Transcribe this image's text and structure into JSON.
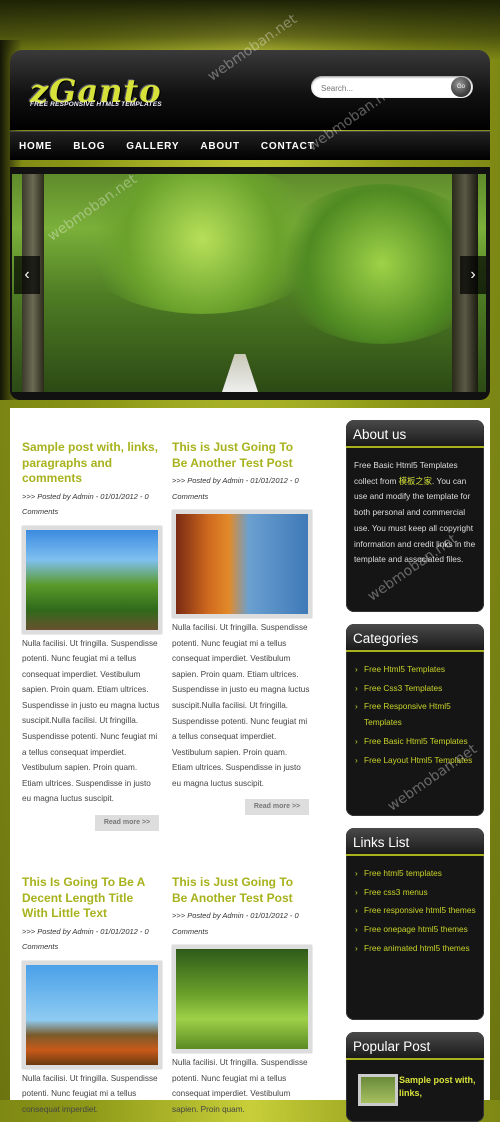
{
  "site": {
    "logo": "zGanto",
    "tagline": "FREE RESPONSIVE HTML5 TEMPLATES"
  },
  "search": {
    "placeholder": "Search...",
    "button_label": "Go"
  },
  "nav": {
    "items": [
      "HOME",
      "BLOG",
      "GALLERY",
      "ABOUT",
      "CONTACT"
    ]
  },
  "slider": {
    "prev_icon": "‹",
    "next_icon": "›"
  },
  "posts": [
    {
      "title": "Sample post with, links, paragraphs and comments",
      "meta": ">>> Posted by Admin - 01/01/2012 - 0 Comments",
      "body": "Nulla facilisi. Ut fringilla. Suspendisse potenti. Nunc feugiat mi a tellus consequat imperdiet. Vestibulum sapien. Proin quam. Etiam ultrices. Suspendisse in justo eu magna luctus suscipit.Nulla facilisi. Ut fringilla. Suspendisse potenti. Nunc feugiat mi a tellus consequat imperdiet. Vestibulum sapien. Proin quam. Etiam ultrices. Suspendisse in justo eu magna luctus suscipit.",
      "read_more": "Read more >>"
    },
    {
      "title": "This is Just Going To Be Another Test Post",
      "meta": ">>> Posted by Admin - 01/01/2012 - 0 Comments",
      "body": "Nulla facilisi. Ut fringilla. Suspendisse potenti. Nunc feugiat mi a tellus consequat imperdiet. Vestibulum sapien. Proin quam. Etiam ultrices. Suspendisse in justo eu magna luctus suscipit.Nulla facilisi. Ut fringilla. Suspendisse potenti. Nunc feugiat mi a tellus consequat imperdiet. Vestibulum sapien. Proin quam. Etiam ultrices. Suspendisse in justo eu magna luctus suscipit.",
      "read_more": "Read more >>"
    },
    {
      "title": "This Is Going To Be A Decent Length Title With Little Text",
      "meta": ">>> Posted by Admin - 01/01/2012 - 0 Comments",
      "body": "Nulla facilisi. Ut fringilla. Suspendisse potenti. Nunc feugiat mi a tellus consequat imperdiet."
    },
    {
      "title": "This is Just Going To Be Another Test Post",
      "meta": ">>> Posted by Admin - 01/01/2012 - 0 Comments",
      "body": "Nulla facilisi. Ut fringilla. Suspendisse potenti. Nunc feugiat mi a tellus consequat imperdiet. Vestibulum sapien. Proin quam."
    }
  ],
  "sidebar": {
    "about": {
      "title": "About us",
      "text_before": "Free Basic Html5 Templates collect from ",
      "link": "模板之家",
      "text_after": ". You can use and modify the template for both personal and commercial use. You must keep all copyright information and credit links in the template and associated files."
    },
    "categories": {
      "title": "Categories",
      "items": [
        "Free Html5 Templates",
        "Free Css3 Templates",
        "Free Responsive Html5 Templates",
        "Free Basic Html5 Templates",
        "Free Layout Html5 Templates"
      ]
    },
    "links": {
      "title": "Links List",
      "items": [
        "Free html5 templates",
        "Free css3 menus",
        "Free responsive html5 themes",
        "Free onepage html5 themes",
        "Free animated html5 themes"
      ]
    },
    "popular": {
      "title": "Popular Post",
      "item_title": "Sample post with, links,"
    }
  },
  "watermark": "webmoban.net",
  "colors": {
    "accent": "#a7b21c",
    "highlight": "#d6e23a",
    "page_bg": "#9aa41c"
  }
}
